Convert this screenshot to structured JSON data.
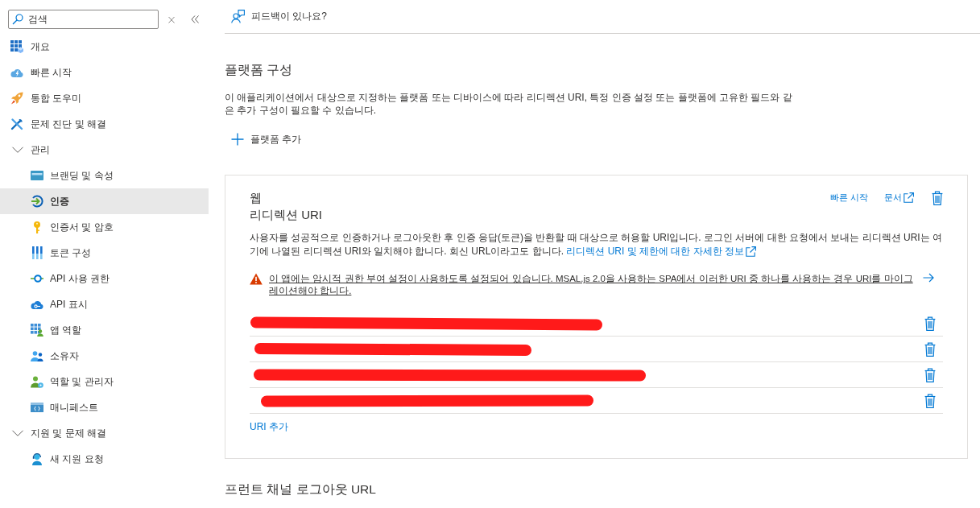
{
  "sidebar": {
    "search": {
      "placeholder": "검색"
    },
    "items": [
      {
        "label": "개요",
        "selected": false
      },
      {
        "label": "빠른 시작",
        "selected": false
      },
      {
        "label": "통합 도우미",
        "selected": false
      },
      {
        "label": "문제 진단 및 해결",
        "selected": false
      },
      {
        "label": "관리",
        "selected": false,
        "expanded": true,
        "children": [
          {
            "label": "브랜딩 및 속성",
            "selected": false
          },
          {
            "label": "인증",
            "selected": true
          },
          {
            "label": "인증서 및 암호",
            "selected": false
          },
          {
            "label": "토큰 구성",
            "selected": false
          },
          {
            "label": "API 사용 권한",
            "selected": false
          },
          {
            "label": "API 표시",
            "selected": false
          },
          {
            "label": "앱 역할",
            "selected": false
          },
          {
            "label": "소유자",
            "selected": false
          },
          {
            "label": "역할 및 관리자",
            "selected": false
          },
          {
            "label": "매니페스트",
            "selected": false
          }
        ]
      },
      {
        "label": "지원 및 문제 해결",
        "selected": false,
        "expanded": true,
        "children": [
          {
            "label": "새 지원 요청",
            "selected": false
          }
        ]
      }
    ]
  },
  "feedback": {
    "label": "피드백이 있나요?"
  },
  "platform_config": {
    "title": "플랫폼 구성",
    "description": "이 애플리케이션에서 대상으로 지정하는 플랫폼 또는 디바이스에 따라 리디렉션 URI, 특정 인증 설정 또는 플랫폼에 고유한 필드와 같은 추가 구성이 필요할 수 있습니다.",
    "add_button": "플랫폼 추가"
  },
  "web_platform": {
    "title": "웹",
    "subtitle": "리디렉션 URI",
    "links": [
      {
        "label": "빠른 시작",
        "external": false
      },
      {
        "label": "문서",
        "external": true
      }
    ],
    "description": "사용자를 성공적으로 인증하거나 로그아웃한 후 인증 응답(토큰)을 반환할 때 대상으로 허용할 URI입니다. 로그인 서버에 대한 요청에서 보내는 리디렉션 URI는 여기에 나열된 리디렉션 URI와 일치해야 합니다. 회신 URL이라고도 합니다.",
    "description_link": "리디렉션 URI 및 제한에 대한 자세한 정보",
    "warning": {
      "text": "이 앱에는 암시적 권한 부여 설정이 사용하도록 설정되어 있습니다. MSAL.js 2.0을 사용하는 SPA에서 이러한 URI 중 하나를 사용하는 경우 URI를 마이그레이션해야 합니다."
    },
    "redirect_uris": [
      {
        "kind": "redacted"
      },
      {
        "kind": "redacted"
      },
      {
        "kind": "redacted"
      },
      {
        "kind": "redacted"
      }
    ],
    "add_uri": "URI 추가"
  },
  "front_channel_logout": {
    "title": "프런트 채널 로그아웃 URL"
  }
}
